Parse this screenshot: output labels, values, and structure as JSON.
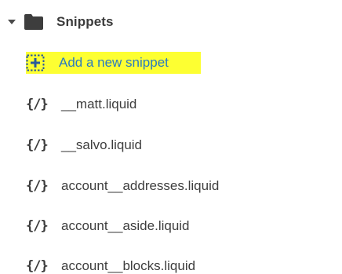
{
  "folder": {
    "label": "Snippets",
    "expanded": true,
    "caret_icon": "caret-down-icon",
    "folder_icon": "folder-icon"
  },
  "add_action": {
    "label": "Add a new snippet",
    "icon": "add-file-icon",
    "highlight_color": "#fdff32",
    "link_color": "#2a7bc0"
  },
  "files": [
    {
      "name": "__matt.liquid",
      "icon_glyph": "{/}"
    },
    {
      "name": "__salvo.liquid",
      "icon_glyph": "{/}"
    },
    {
      "name": "account__addresses.liquid",
      "icon_glyph": "{/}"
    },
    {
      "name": "account__aside.liquid",
      "icon_glyph": "{/}"
    },
    {
      "name": "account__blocks.liquid",
      "icon_glyph": "{/}"
    }
  ]
}
